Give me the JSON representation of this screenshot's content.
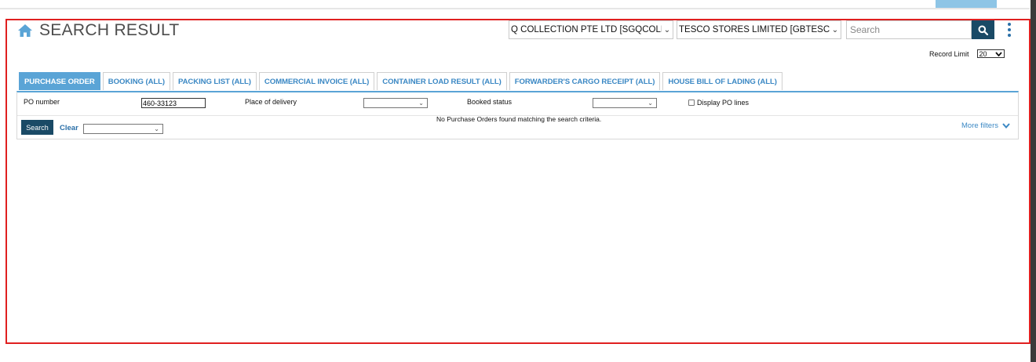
{
  "header": {
    "title": "SEARCH RESULT",
    "icon": "home-icon",
    "company_select": "Q COLLECTION PTE LTD [SGQCOLLECTION]",
    "customer_select": "TESCO STORES LIMITED [GBTESCO]",
    "search_placeholder": "Search",
    "search_icon": "search-icon",
    "menu_icon": "kebab-icon"
  },
  "record_limit": {
    "label": "Record Limit",
    "value": "20"
  },
  "tabs": [
    {
      "label": "PURCHASE ORDER"
    },
    {
      "label": "BOOKING (ALL)"
    },
    {
      "label": "PACKING LIST (ALL)"
    },
    {
      "label": "COMMERCIAL INVOICE (ALL)"
    },
    {
      "label": "CONTAINER LOAD RESULT (ALL)"
    },
    {
      "label": "FORWARDER'S CARGO RECEIPT (ALL)"
    },
    {
      "label": "HOUSE BILL OF LADING (ALL)"
    }
  ],
  "filters": {
    "po_number_label": "PO number",
    "po_number_value": "460-33123",
    "place_of_delivery_label": "Place of delivery",
    "place_of_delivery_value": "",
    "booked_status_label": "Booked status",
    "booked_status_value": "",
    "display_po_lines_label": "Display PO lines"
  },
  "actions": {
    "search_label": "Search",
    "clear_label": "Clear",
    "preset_value": "",
    "more_filters_label": "More filters"
  },
  "message": "No Purchase Orders found matching the search criteria.",
  "colors": {
    "accent": "#5aa4d6",
    "dark_button": "#1a4a66",
    "link": "#3b88c4",
    "frame": "#e02020"
  }
}
